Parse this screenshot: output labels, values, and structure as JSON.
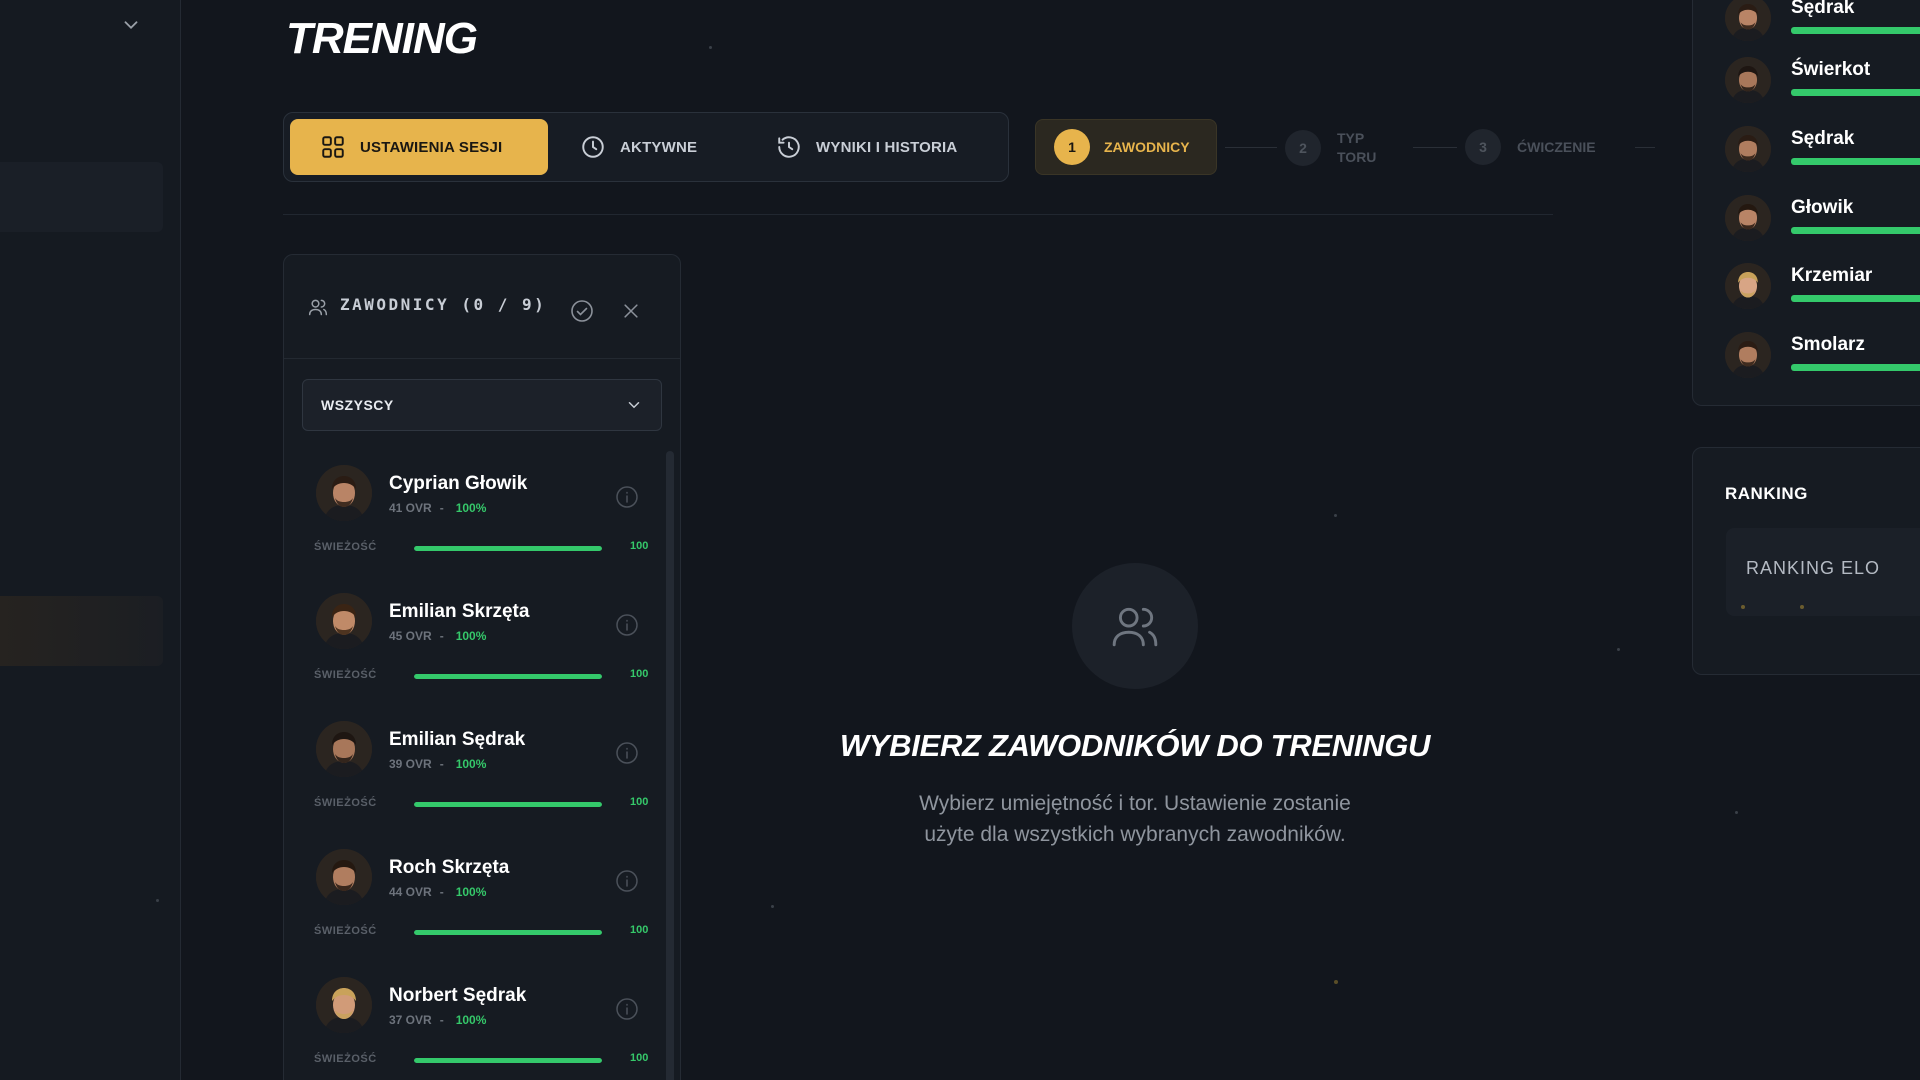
{
  "page": {
    "title": "TRENING"
  },
  "tabs": [
    {
      "label": "USTAWIENIA SESJI",
      "icon": "grid-icon",
      "active": true
    },
    {
      "label": "AKTYWNE",
      "icon": "clock-icon",
      "active": false
    },
    {
      "label": "WYNIKI I HISTORIA",
      "icon": "history-icon",
      "active": false
    }
  ],
  "steps": [
    {
      "num": "1",
      "label": "ZAWODNICY",
      "active": true
    },
    {
      "num": "2",
      "label": "TYP TORU",
      "active": false
    },
    {
      "num": "3",
      "label": "ĆWICZENIE",
      "active": false
    }
  ],
  "players_panel": {
    "title": "ZAWODNICY (0 / 9)",
    "filter_value": "WSZYSCY",
    "freshness_label": "ŚWIEŻOŚĆ",
    "players": [
      {
        "name": "Cyprian Głowik",
        "ovr": "41 OVR",
        "sep": "-",
        "pct": "100%",
        "freshness": 100,
        "freshness_text": "100"
      },
      {
        "name": "Emilian Skrzęta",
        "ovr": "45 OVR",
        "sep": "-",
        "pct": "100%",
        "freshness": 100,
        "freshness_text": "100"
      },
      {
        "name": "Emilian Sędrak",
        "ovr": "39 OVR",
        "sep": "-",
        "pct": "100%",
        "freshness": 100,
        "freshness_text": "100"
      },
      {
        "name": "Roch Skrzęta",
        "ovr": "44 OVR",
        "sep": "-",
        "pct": "100%",
        "freshness": 100,
        "freshness_text": "100"
      },
      {
        "name": "Norbert Sędrak",
        "ovr": "37 OVR",
        "sep": "-",
        "pct": "100%",
        "freshness": 100,
        "freshness_text": "100"
      }
    ]
  },
  "empty_state": {
    "icon": "users-icon",
    "title": "WYBIERZ ZAWODNIKÓW DO TRENINGU",
    "desc_line1": "Wybierz umiejętność i tor. Ustawienie zostanie",
    "desc_line2": "użyte dla wszystkich wybranych zawodników."
  },
  "side_list": {
    "players": [
      {
        "name": "Sędrak"
      },
      {
        "name": "Świerkot"
      },
      {
        "name": "Sędrak"
      },
      {
        "name": "Głowik"
      },
      {
        "name": "Krzemiar"
      },
      {
        "name": "Smolarz"
      }
    ]
  },
  "ranking": {
    "title": "RANKING",
    "subtitle": "RANKING ELO"
  },
  "colors": {
    "accent": "#e7b44c",
    "green": "#34c96b",
    "background": "#12161d",
    "panel": "#161b22"
  }
}
